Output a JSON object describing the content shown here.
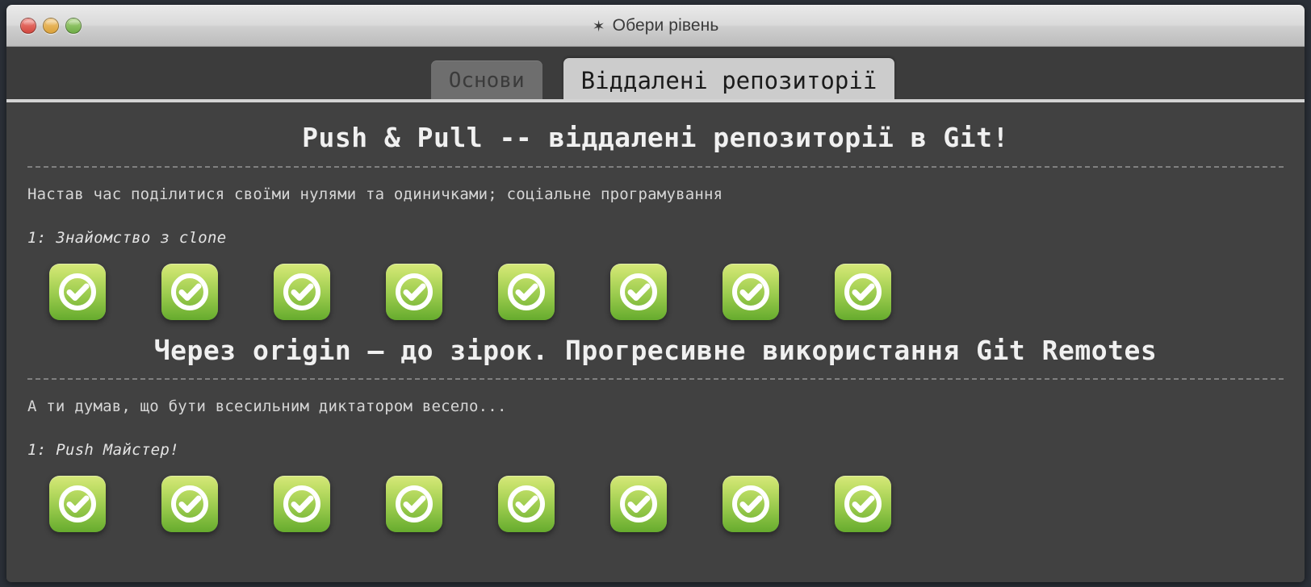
{
  "window": {
    "title": "Обери рівень",
    "gear_icon": "gear-icon",
    "traffic_lights": {
      "close": "close",
      "minimize": "minimize",
      "maximize": "maximize"
    }
  },
  "tabs": [
    {
      "label": "Основи",
      "active": false
    },
    {
      "label": "Віддалені репозиторії",
      "active": true
    }
  ],
  "sections": [
    {
      "title": "Push & Pull -- віддалені репозиторії в Git!",
      "description": "Настав час поділитися своїми нулями та одиничками; соціальне програмування",
      "sequence_label": "1: Знайомство з clone",
      "levels": [
        {
          "index": 1,
          "status": "completed"
        },
        {
          "index": 2,
          "status": "completed"
        },
        {
          "index": 3,
          "status": "completed"
        },
        {
          "index": 4,
          "status": "completed"
        },
        {
          "index": 5,
          "status": "completed"
        },
        {
          "index": 6,
          "status": "completed"
        },
        {
          "index": 7,
          "status": "completed"
        },
        {
          "index": 8,
          "status": "completed"
        }
      ]
    },
    {
      "title": "Через origin — до зірок. Прогресивне використання Git Remotes",
      "description": "А ти думав, що бути всесильним диктатором весело...",
      "sequence_label": "1: Push Майстер!",
      "levels": [
        {
          "index": 1,
          "status": "completed"
        },
        {
          "index": 2,
          "status": "completed"
        },
        {
          "index": 3,
          "status": "completed"
        },
        {
          "index": 4,
          "status": "completed"
        },
        {
          "index": 5,
          "status": "completed"
        },
        {
          "index": 6,
          "status": "completed"
        },
        {
          "index": 7,
          "status": "completed"
        },
        {
          "index": 8,
          "status": "completed"
        }
      ]
    }
  ],
  "colors": {
    "badge_top": "#d6e87a",
    "badge_bottom": "#66ab2e",
    "window_body": "#414141",
    "tab_active_bg": "#cccccc",
    "tab_inactive_bg": "#6e6e6e",
    "desktop_bg": "#2b3038"
  }
}
